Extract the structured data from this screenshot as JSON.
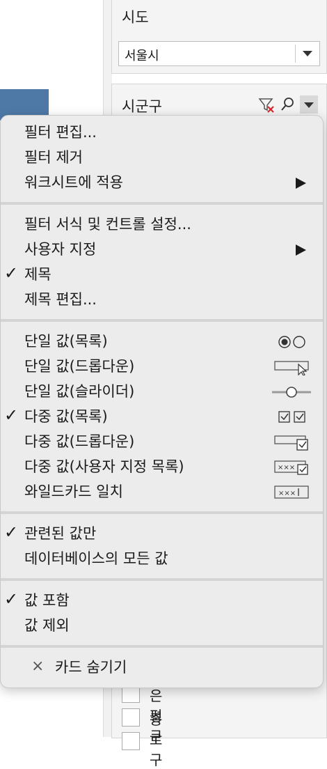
{
  "filters": {
    "sido": {
      "title": "시도",
      "value": "서울시"
    },
    "sigungu": {
      "title": "시군구",
      "visible_items": [
        "은평구",
        "종로구"
      ]
    }
  },
  "menu": {
    "group1": [
      "필터 편집...",
      "필터 제거",
      "워크시트에 적용"
    ],
    "group2": [
      "필터 서식 및 컨트롤 설정...",
      "사용자 지정",
      "제목",
      "제목 편집..."
    ],
    "group3": [
      "단일 값(목록)",
      "단일 값(드롭다운)",
      "단일 값(슬라이더)",
      "다중 값(목록)",
      "다중 값(드롭다운)",
      "다중 값(사용자 지정 목록)",
      "와일드카드 일치"
    ],
    "group4": [
      "관련된 값만",
      "데이터베이스의 모든 값"
    ],
    "group5": [
      "값 포함",
      "값 제외"
    ],
    "hide_card": "카드 숨기기",
    "check_glyph": "✓",
    "close_glyph": "×"
  },
  "colors": {
    "accent_blue": "#4e79a7",
    "filter_x_red": "#d9262d"
  }
}
